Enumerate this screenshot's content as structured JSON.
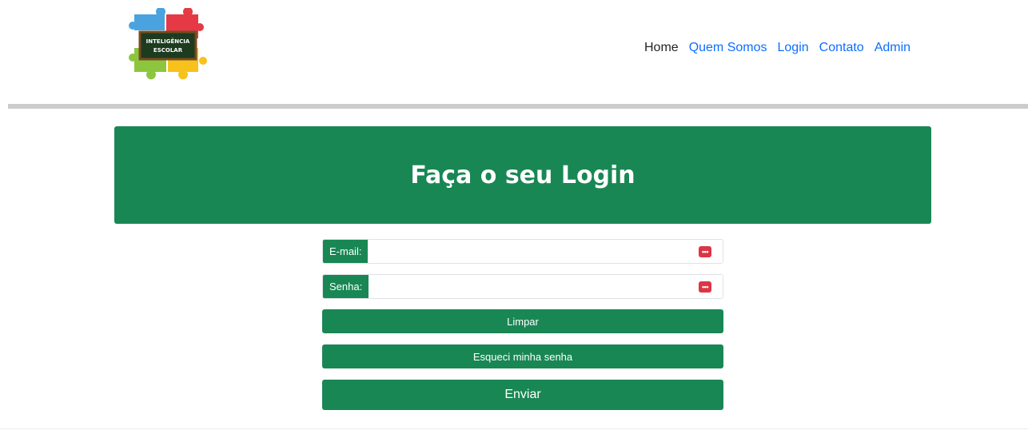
{
  "logo": {
    "line1": "INTELIGÊNCIA",
    "line2": "ESCOLAR"
  },
  "nav": {
    "items": [
      {
        "label": "Home"
      },
      {
        "label": "Quem Somos"
      },
      {
        "label": "Login"
      },
      {
        "label": "Contato"
      },
      {
        "label": "Admin"
      }
    ]
  },
  "banner": {
    "title": "Faça o seu Login"
  },
  "form": {
    "email_label": "E-mail:",
    "email_value": "",
    "password_label": "Senha:",
    "password_value": "",
    "clear_button": "Limpar",
    "forgot_button": "Esqueci minha senha",
    "submit_button": "Enviar"
  },
  "icons": {
    "password_manager": "password-manager-icon"
  },
  "colors": {
    "primary_green": "#198754",
    "link_blue": "#0d6efd",
    "icon_red": "#dc3545",
    "divider_gray": "#cccccc"
  }
}
